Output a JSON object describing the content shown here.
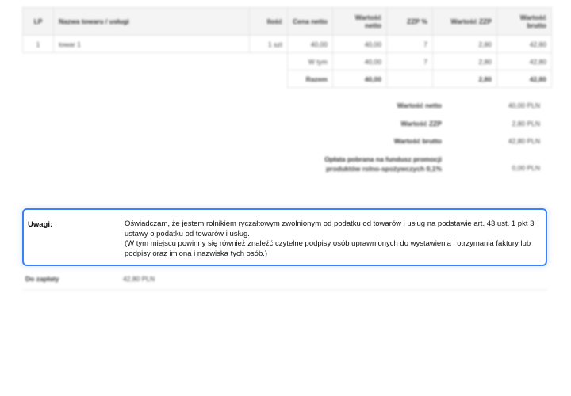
{
  "table": {
    "headers": {
      "lp": "LP",
      "name": "Nazwa towaru / usługi",
      "qty": "Ilość",
      "net_price": "Cena netto",
      "net_value": "Wartość netto",
      "rate": "ZZP %",
      "tax_value": "Wartość ZZP",
      "gross_l1": "Wartość",
      "gross_l2": "brutto"
    },
    "rows": [
      {
        "lp": "1",
        "name": "towar 1",
        "qty": "1 szt",
        "net_price": "40,00",
        "net_value": "40,00",
        "rate": "7",
        "tax_value": "2,80",
        "gross": "42,80"
      }
    ],
    "wtym": {
      "label": "W tym",
      "net_value": "40,00",
      "rate": "7",
      "tax_value": "2,80",
      "gross": "42,80"
    },
    "razem": {
      "label": "Razem",
      "net_value": "40,00",
      "rate": "",
      "tax_value": "2,80",
      "gross": "42,80"
    }
  },
  "summary": {
    "net": {
      "label": "Wartość netto",
      "value": "40,00 PLN"
    },
    "tax": {
      "label": "Wartość ZZP",
      "value": "2,80 PLN"
    },
    "gross": {
      "label": "Wartość brutto",
      "value": "42,80 PLN"
    },
    "fund": {
      "label_l1": "Opłata pobrana na fundusz promocji",
      "label_l2": "produktów rolno-spożywczych 0,1%",
      "value": "0,00 PLN"
    }
  },
  "notes": {
    "label": "Uwagi:",
    "line1": "Oświadczam, że jestem rolnikiem ryczałtowym zwolnionym od podatku od towarów i usług na podstawie art. 43 ust. 1 pkt 3",
    "line2": "ustawy o podatku od towarów i usług.",
    "line3": "(W tym miejscu powinny się również znaleźć czytelne podpisy osób uprawnionych do wystawienia i otrzymania faktury lub",
    "line4": "podpisy oraz imiona i nazwiska tych osób.)"
  },
  "payment": {
    "label": "Do zapłaty",
    "value": "42,80 PLN"
  },
  "colors": {
    "focus_border": "#3b82f6"
  }
}
